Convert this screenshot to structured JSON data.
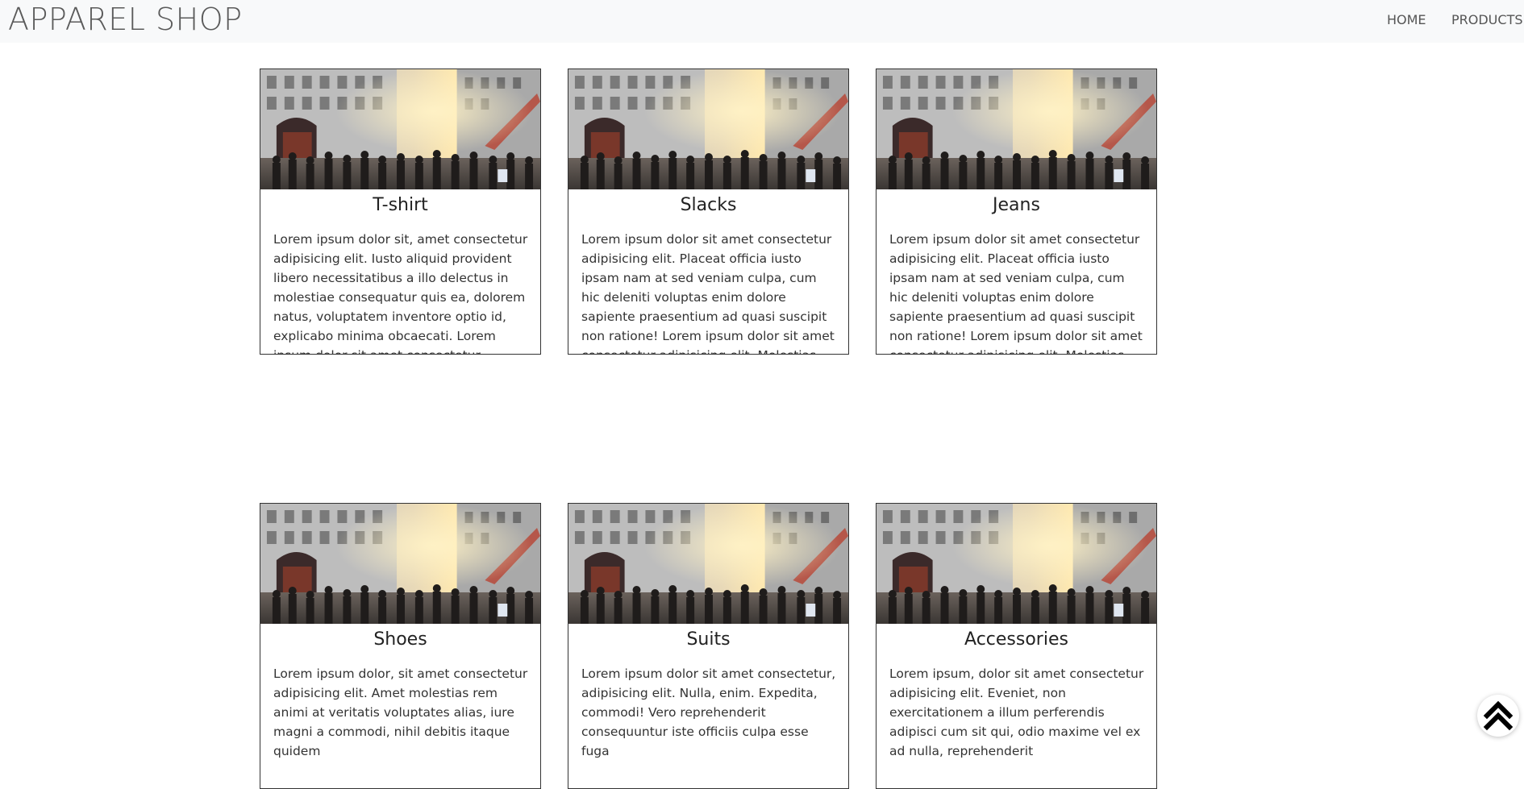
{
  "navbar": {
    "brand": "APPAREL SHOP",
    "links": [
      {
        "label": "HOME"
      },
      {
        "label": "PRODUCTS"
      }
    ]
  },
  "products": [
    {
      "title": "T-shirt",
      "text": "Lorem ipsum dolor sit, amet consectetur adipisicing elit. Iusto aliquid provident libero necessitatibus a illo delectus in molestiae consequatur quis ea, dolorem natus, voluptatem inventore optio id, explicabo minima obcaecati. Lorem ipsum dolor sit amet consectetur adipisicing elit. Molestias, ducimus. Facilis eligendi beatae laudantium sit temporibus odit magni quidem earum amet fuga nemo asperiores quae, corporis numquam aspernatur, saepe enim."
    },
    {
      "title": "Slacks",
      "text": "Lorem ipsum dolor sit amet consectetur adipisicing elit. Placeat officia iusto ipsam nam at sed veniam culpa, cum hic deleniti voluptas enim dolore sapiente praesentium ad quasi suscipit non ratione! Lorem ipsum dolor sit amet consectetur adipisicing elit. Molestias, ducimus. Facilis eligendi beatae laudantium sit temporibus odit magni quidem earum amet fuga nemo asperiores quae, corporis numquam aspernatur, saepe enim."
    },
    {
      "title": "Jeans",
      "text": "Lorem ipsum dolor sit amet consectetur adipisicing elit. Placeat officia iusto ipsam nam at sed veniam culpa, cum hic deleniti voluptas enim dolore sapiente praesentium ad quasi suscipit non ratione! Lorem ipsum dolor sit amet consectetur adipisicing elit. Molestias, ducimus. Facilis eligendi beatae laudantium sit temporibus odit magni quidem earum amet fuga nemo asperiores quae, corporis numquam aspernatur, saepe enim."
    },
    {
      "title": "Shoes",
      "text": "Lorem ipsum dolor, sit amet consectetur adipisicing elit. Amet molestias rem animi at veritatis voluptates alias, iure magni a commodi, nihil debitis itaque quidem"
    },
    {
      "title": "Suits",
      "text": "Lorem ipsum dolor sit amet consectetur, adipisicing elit. Nulla, enim. Expedita, commodi! Vero reprehenderit consequuntur iste officiis culpa esse fuga"
    },
    {
      "title": "Accessories",
      "text": "Lorem ipsum, dolor sit amet consectetur adipisicing elit. Eveniet, non exercitationem a illum perferendis adipisci cum sit qui, odio maxime vel ex ad nulla, reprehenderit"
    }
  ],
  "scroll_top": {
    "icon": "double-chevron-up-icon"
  }
}
